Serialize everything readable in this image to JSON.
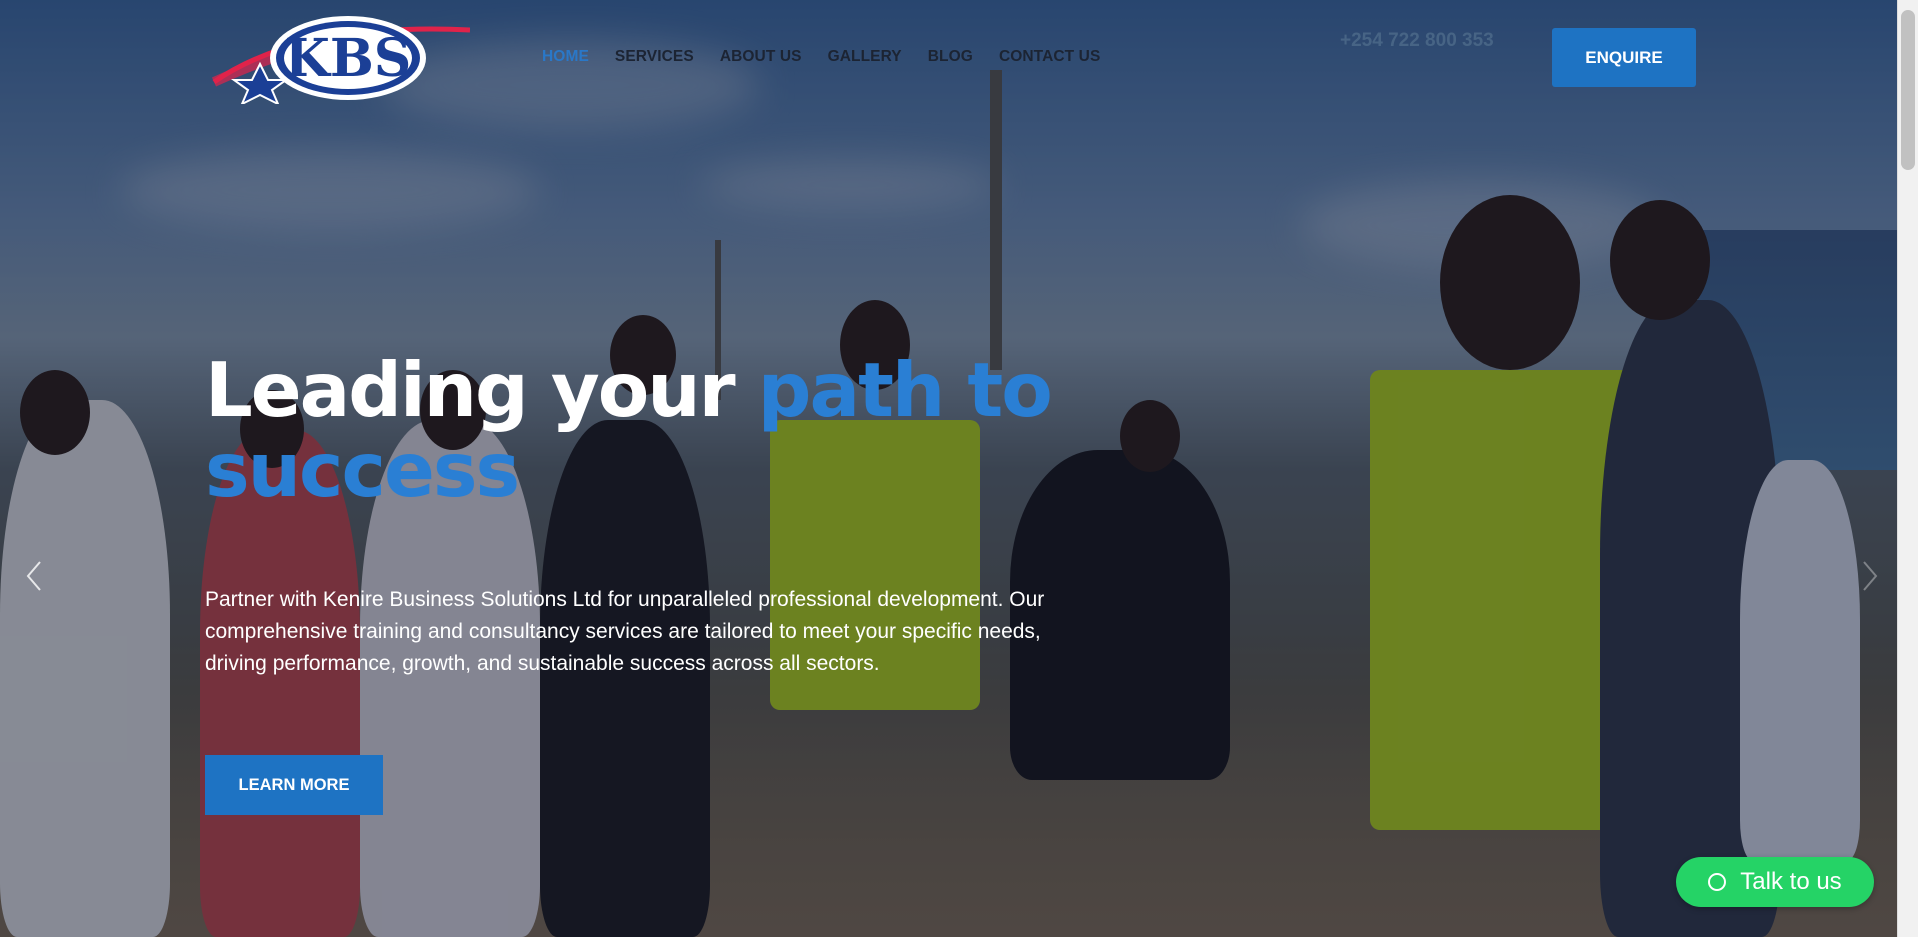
{
  "logo": {
    "text": "KBS"
  },
  "nav": [
    {
      "label": "HOME",
      "active": true
    },
    {
      "label": "SERVICES",
      "active": false
    },
    {
      "label": "ABOUT US",
      "active": false
    },
    {
      "label": "GALLERY",
      "active": false
    },
    {
      "label": "BLOG",
      "active": false
    },
    {
      "label": "CONTACT US",
      "active": false
    }
  ],
  "header": {
    "phone": "+254 722 800 353",
    "enquire_label": "ENQUIRE"
  },
  "hero": {
    "headline_white": "Leading your ",
    "headline_accent_1": "path to",
    "headline_accent_2": "success",
    "description": "Partner with Kenire Business Solutions Ltd for unparalleled professional development. Our comprehensive training and consultancy services are tailored to meet your specific needs, driving performance, growth, and sustainable success across all sectors.",
    "cta_label": "LEARN MORE"
  },
  "slider": {
    "prev_icon": "chevron-left-icon",
    "next_icon": "chevron-right-icon"
  },
  "chat": {
    "label": "Talk to us",
    "icon": "whatsapp-icon"
  },
  "colors": {
    "accent": "#1e73c3",
    "chat": "#25d366",
    "nav_text": "#1c2433"
  }
}
